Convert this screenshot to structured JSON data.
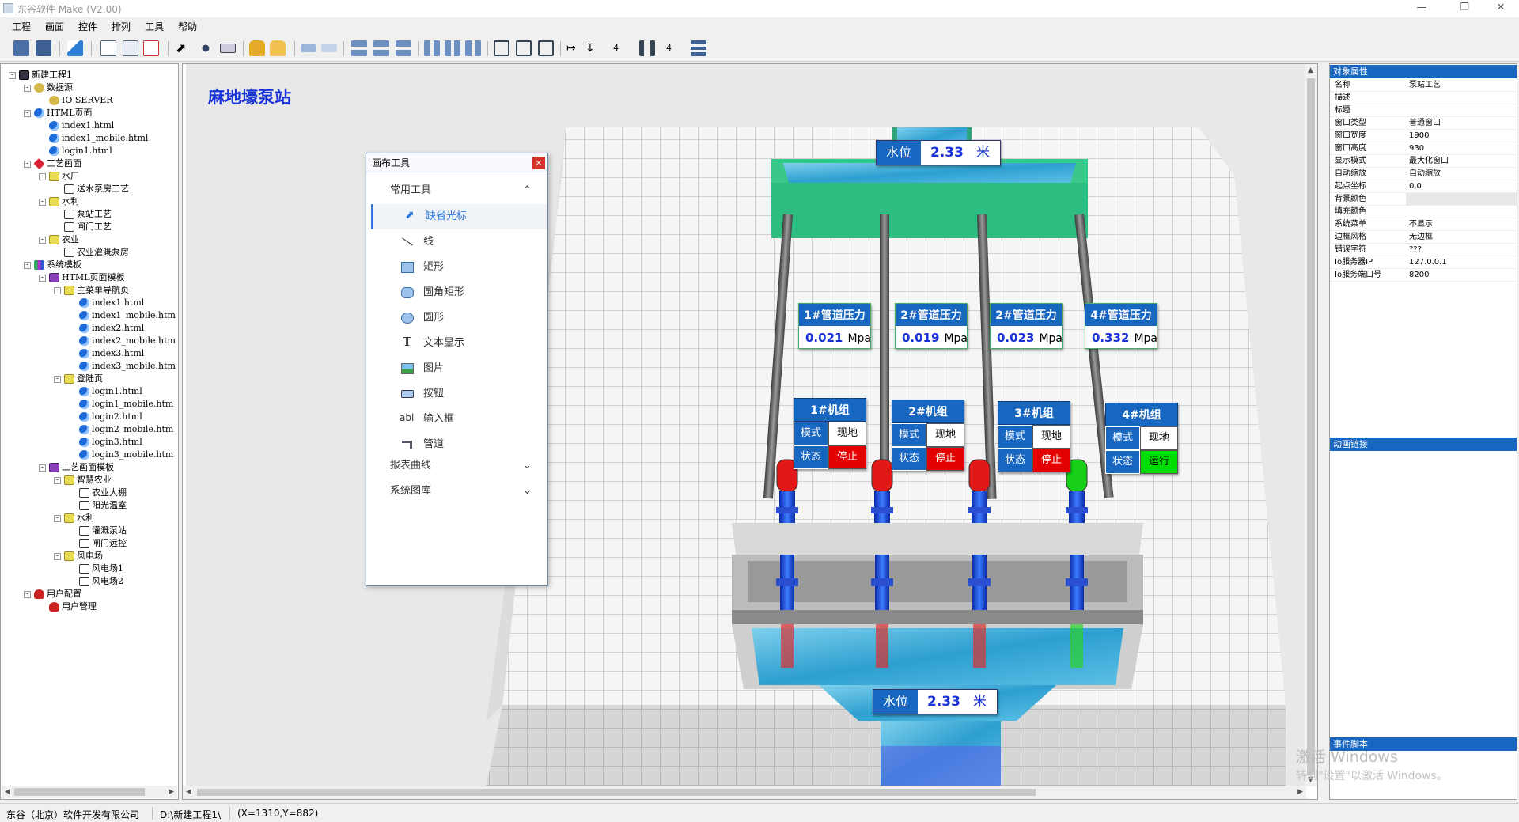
{
  "window": {
    "title": "东谷软件 Make (V2.00)"
  },
  "menu": [
    "工程",
    "画面",
    "控件",
    "排列",
    "工具",
    "帮助"
  ],
  "toolbar": {
    "spacing_h": "4",
    "spacing_v": "4"
  },
  "tree": [
    {
      "label": "新建工程1",
      "icon": "root",
      "indent": 0,
      "ex": "-"
    },
    {
      "label": "数据源",
      "icon": "db",
      "indent": 1,
      "ex": "-"
    },
    {
      "label": "IO SERVER",
      "icon": "db",
      "indent": 2,
      "ex": ""
    },
    {
      "label": "HTML页面",
      "icon": "ie",
      "indent": 1,
      "ex": "-"
    },
    {
      "label": "index1.html",
      "icon": "ie",
      "indent": 2,
      "ex": ""
    },
    {
      "label": "index1_mobile.html",
      "icon": "ie",
      "indent": 2,
      "ex": ""
    },
    {
      "label": "login1.html",
      "icon": "ie",
      "indent": 2,
      "ex": ""
    },
    {
      "label": "工艺画面",
      "icon": "proc",
      "indent": 1,
      "ex": "-"
    },
    {
      "label": "水厂",
      "icon": "fold",
      "indent": 2,
      "ex": "-"
    },
    {
      "label": "送水泵房工艺",
      "icon": "scr",
      "indent": 3,
      "ex": ""
    },
    {
      "label": "水利",
      "icon": "fold",
      "indent": 2,
      "ex": "-"
    },
    {
      "label": "泵站工艺",
      "icon": "scr",
      "indent": 3,
      "ex": ""
    },
    {
      "label": "闸门工艺",
      "icon": "scr",
      "indent": 3,
      "ex": ""
    },
    {
      "label": "农业",
      "icon": "fold",
      "indent": 2,
      "ex": "-"
    },
    {
      "label": "农业灌溉泵房",
      "icon": "scr",
      "indent": 3,
      "ex": ""
    },
    {
      "label": "系统模板",
      "icon": "bars",
      "indent": 1,
      "ex": "-"
    },
    {
      "label": "HTML页面模板",
      "icon": "tpl",
      "indent": 2,
      "ex": "-"
    },
    {
      "label": "主菜单导航页",
      "icon": "fold",
      "indent": 3,
      "ex": "-"
    },
    {
      "label": "index1.html",
      "icon": "ie",
      "indent": 4,
      "ex": ""
    },
    {
      "label": "index1_mobile.htm",
      "icon": "ie",
      "indent": 4,
      "ex": ""
    },
    {
      "label": "index2.html",
      "icon": "ie",
      "indent": 4,
      "ex": ""
    },
    {
      "label": "index2_mobile.htm",
      "icon": "ie",
      "indent": 4,
      "ex": ""
    },
    {
      "label": "index3.html",
      "icon": "ie",
      "indent": 4,
      "ex": ""
    },
    {
      "label": "index3_mobile.htm",
      "icon": "ie",
      "indent": 4,
      "ex": ""
    },
    {
      "label": "登陆页",
      "icon": "fold",
      "indent": 3,
      "ex": "-"
    },
    {
      "label": "login1.html",
      "icon": "ie",
      "indent": 4,
      "ex": ""
    },
    {
      "label": "login1_mobile.htm",
      "icon": "ie",
      "indent": 4,
      "ex": ""
    },
    {
      "label": "login2.html",
      "icon": "ie",
      "indent": 4,
      "ex": ""
    },
    {
      "label": "login2_mobile.htm",
      "icon": "ie",
      "indent": 4,
      "ex": ""
    },
    {
      "label": "login3.html",
      "icon": "ie",
      "indent": 4,
      "ex": ""
    },
    {
      "label": "login3_mobile.htm",
      "icon": "ie",
      "indent": 4,
      "ex": ""
    },
    {
      "label": "工艺画面模板",
      "icon": "tpl",
      "indent": 2,
      "ex": "-"
    },
    {
      "label": "智慧农业",
      "icon": "fold",
      "indent": 3,
      "ex": "-"
    },
    {
      "label": "农业大棚",
      "icon": "scr",
      "indent": 4,
      "ex": ""
    },
    {
      "label": "阳光温室",
      "icon": "scr",
      "indent": 4,
      "ex": ""
    },
    {
      "label": "水利",
      "icon": "fold",
      "indent": 3,
      "ex": "-"
    },
    {
      "label": "灌溉泵站",
      "icon": "scr",
      "indent": 4,
      "ex": ""
    },
    {
      "label": "闸门远控",
      "icon": "scr",
      "indent": 4,
      "ex": ""
    },
    {
      "label": "风电场",
      "icon": "fold",
      "indent": 3,
      "ex": "-"
    },
    {
      "label": "风电场1",
      "icon": "scr",
      "indent": 4,
      "ex": ""
    },
    {
      "label": "风电场2",
      "icon": "scr",
      "indent": 4,
      "ex": ""
    },
    {
      "label": "用户配置",
      "icon": "user",
      "indent": 1,
      "ex": "-"
    },
    {
      "label": "用户管理",
      "icon": "user",
      "indent": 2,
      "ex": ""
    }
  ],
  "canvas": {
    "title": "麻地壕泵站",
    "water_top": {
      "label": "水位",
      "value": "2.33",
      "unit": "米"
    },
    "water_bottom": {
      "label": "水位",
      "value": "2.33",
      "unit": "米"
    },
    "pressures": [
      {
        "label": "1#管道压力",
        "value": "0.021",
        "unit": "Mpa"
      },
      {
        "label": "2#管道压力",
        "value": "0.019",
        "unit": "Mpa"
      },
      {
        "label": "2#管道压力",
        "value": "0.023",
        "unit": "Mpa"
      },
      {
        "label": "4#管道压力",
        "value": "0.332",
        "unit": "Mpa"
      }
    ],
    "units": [
      {
        "label": "1#机组",
        "mode_key": "模式",
        "mode": "现地",
        "state_key": "状态",
        "state": "停止",
        "running": false
      },
      {
        "label": "2#机组",
        "mode_key": "模式",
        "mode": "现地",
        "state_key": "状态",
        "state": "停止",
        "running": false
      },
      {
        "label": "3#机组",
        "mode_key": "模式",
        "mode": "现地",
        "state_key": "状态",
        "state": "停止",
        "running": false
      },
      {
        "label": "4#机组",
        "mode_key": "模式",
        "mode": "现地",
        "state_key": "状态",
        "state": "运行",
        "running": true
      }
    ]
  },
  "palette": {
    "title": "画布工具",
    "close": "×",
    "section_common": "常用工具",
    "items": [
      "缺省光标",
      "线",
      "矩形",
      "圆角矩形",
      "圆形",
      "文本显示",
      "图片",
      "按钮",
      "输入框",
      "管道"
    ],
    "section_report": "报表曲线",
    "section_library": "系统图库"
  },
  "props": {
    "header": "对象属性",
    "rows": [
      {
        "k": "名称",
        "v": "泵站工艺"
      },
      {
        "k": "描述",
        "v": ""
      },
      {
        "k": "标题",
        "v": ""
      },
      {
        "k": "窗口类型",
        "v": "普通窗口"
      },
      {
        "k": "窗口宽度",
        "v": "1900"
      },
      {
        "k": "窗口高度",
        "v": "930"
      },
      {
        "k": "显示模式",
        "v": "最大化窗口"
      },
      {
        "k": "自动缩放",
        "v": "自动缩放"
      },
      {
        "k": "起点坐标",
        "v": "0,0"
      },
      {
        "k": "背景颜色",
        "v": ""
      },
      {
        "k": "填充颜色",
        "v": ""
      },
      {
        "k": "系统菜单",
        "v": "不显示"
      },
      {
        "k": "边框风格",
        "v": "无边框"
      },
      {
        "k": "错误字符",
        "v": "???"
      },
      {
        "k": "Io服务器IP",
        "v": "127.0.0.1"
      },
      {
        "k": "Io服务端口号",
        "v": "8200"
      }
    ],
    "anim_header": "动画链接",
    "script_header": "事件脚本"
  },
  "watermark": {
    "line1": "激活 Windows",
    "line2": "转到\"设置\"以激活 Windows。"
  },
  "status": {
    "company": "东谷（北京）软件开发有限公司",
    "path": "D:\\新建工程1\\",
    "coords": "(X=1310,Y=882)"
  }
}
